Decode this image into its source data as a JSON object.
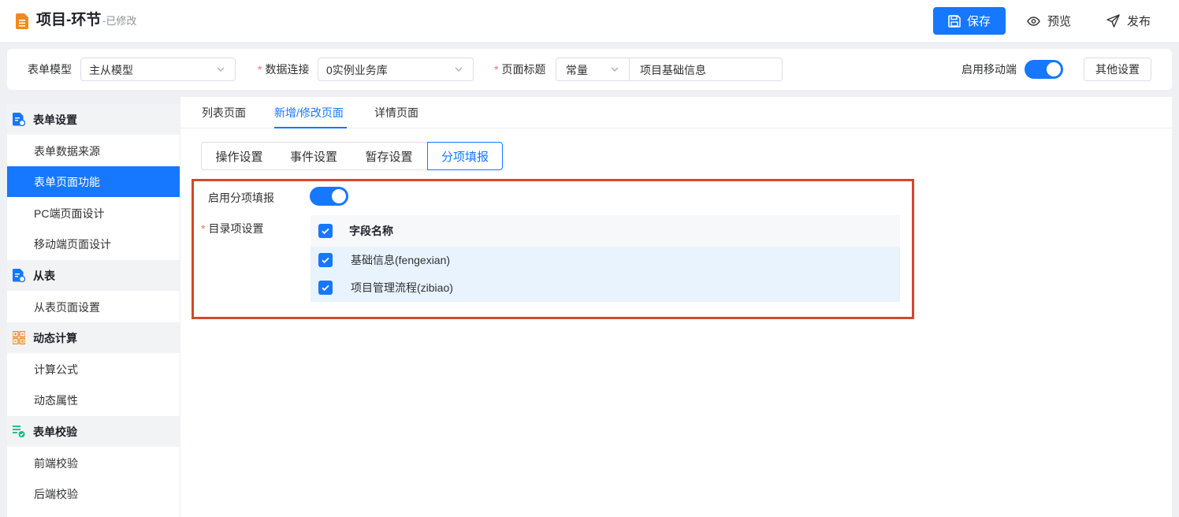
{
  "header": {
    "title": "项目-环节",
    "status": "-已修改",
    "save_label": "保存",
    "preview_label": "预览",
    "publish_label": "发布"
  },
  "config": {
    "form_model_label": "表单模型",
    "form_model_value": "主从模型",
    "data_conn_label": "数据连接",
    "data_conn_value": "0实例业务库",
    "page_title_label": "页面标题",
    "page_title_mode": "常量",
    "page_title_value": "项目基础信息",
    "mobile_label": "启用移动端",
    "mobile_enabled": true,
    "other_settings_label": "其他设置"
  },
  "sidebar": {
    "groups": [
      {
        "label": "表单设置",
        "icon": "form-settings-icon",
        "items": [
          "表单数据来源",
          "表单页面功能",
          "PC端页面设计",
          "移动端页面设计"
        ]
      },
      {
        "label": "从表",
        "icon": "subtable-icon",
        "items": [
          "从表页面设置"
        ]
      },
      {
        "label": "动态计算",
        "icon": "calculator-icon",
        "items": [
          "计算公式",
          "动态属性"
        ]
      },
      {
        "label": "表单校验",
        "icon": "validation-icon",
        "items": [
          "前端校验",
          "后端校验"
        ]
      }
    ],
    "active_item": "表单页面功能"
  },
  "tabs": [
    "列表页面",
    "新增/修改页面",
    "详情页面"
  ],
  "active_tab": "新增/修改页面",
  "sub_tabs": [
    "操作设置",
    "事件设置",
    "暂存设置",
    "分项填报"
  ],
  "active_sub_tab": "分项填报",
  "section": {
    "enable_label": "启用分项填报",
    "enabled": true,
    "catalog_label": "目录项设置",
    "table": {
      "header": "字段名称",
      "rows": [
        "基础信息(fengexian)",
        "项目管理流程(zibiao)"
      ]
    }
  },
  "colors": {
    "primary": "#1677ff",
    "highlight": "#d4472d",
    "required": "#f56c6c",
    "row_selected": "#e8f3fe",
    "form_icon": "#1677ff",
    "calc_icon": "#f08a24",
    "valid_icon": "#12b886"
  }
}
